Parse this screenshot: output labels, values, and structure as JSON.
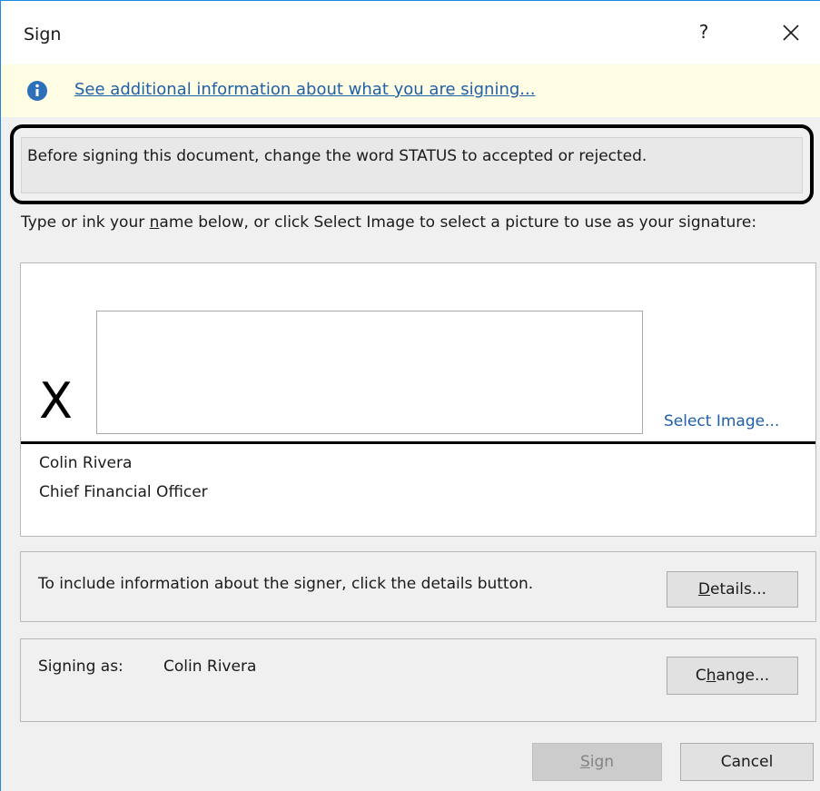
{
  "dialog": {
    "title": "Sign",
    "help_label": "?",
    "close_icon": "close-icon"
  },
  "infobar": {
    "icon": "info-icon",
    "link_text": "See additional information about what you are signing..."
  },
  "instructions": {
    "text": "Before signing this document, change the word STATUS to accepted or rejected."
  },
  "prompt": {
    "before_mnemonic": "Type or ink your ",
    "mnemonic": "n",
    "after_mnemonic": "ame below, or click Select Image to select a picture to use as your signature:"
  },
  "signature": {
    "x_mark": "X",
    "input_value": "",
    "select_image_label": "Select Image...",
    "signer_name": "Colin Rivera",
    "signer_title": "Chief Financial Officer"
  },
  "details": {
    "text": "To include information about the signer, click the details button.",
    "button_mnemonic": "D",
    "button_rest": "etails..."
  },
  "signing_as": {
    "label": "Signing as:",
    "name": "Colin Rivera",
    "change_before": "C",
    "change_mnemonic": "h",
    "change_after": "ange..."
  },
  "footer": {
    "sign_mnemonic": "S",
    "sign_rest": "ign",
    "sign_enabled": false,
    "cancel_label": "Cancel"
  },
  "colors": {
    "accent_border": "#1e88e5",
    "link": "#1f5fa8",
    "infobar_bg": "#fffde3",
    "dialog_bg": "#f0f0f0"
  }
}
